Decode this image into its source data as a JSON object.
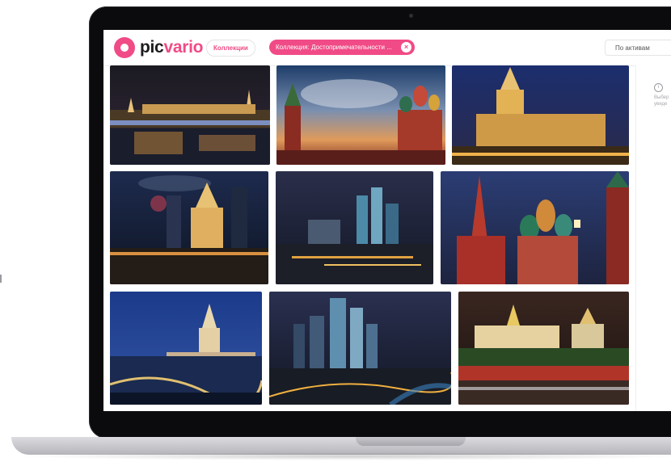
{
  "header": {
    "logo_prefix": "pic",
    "logo_accent": "vario",
    "collections_label": "Коллекции",
    "filter_chip_label": "Коллекция: Достопримечательности ...",
    "filter_chip_close": "×",
    "sort_label": "По активам",
    "sort_chevron": "⌄"
  },
  "sidebar": {
    "info_glyph": "i",
    "hint_line1": "Выбер",
    "hint_line2": "увиде"
  },
  "theme": {
    "accent": "#f04b86",
    "text": "#1d1d1f",
    "border": "#e4e4e8"
  },
  "gallery": {
    "tiles": [
      {
        "name": "moscow-river-kremlin-night"
      },
      {
        "name": "red-square-st-basils-sunset"
      },
      {
        "name": "stalinist-skyscraper-night"
      },
      {
        "name": "hotel-ukraina-night-city"
      },
      {
        "name": "moscow-city-towers-dusk"
      },
      {
        "name": "st-basils-kremlin-dusk"
      },
      {
        "name": "hotel-ukraina-river-blue-hour"
      },
      {
        "name": "moscow-city-business-center-night"
      },
      {
        "name": "grand-kremlin-palace-evening"
      }
    ]
  }
}
